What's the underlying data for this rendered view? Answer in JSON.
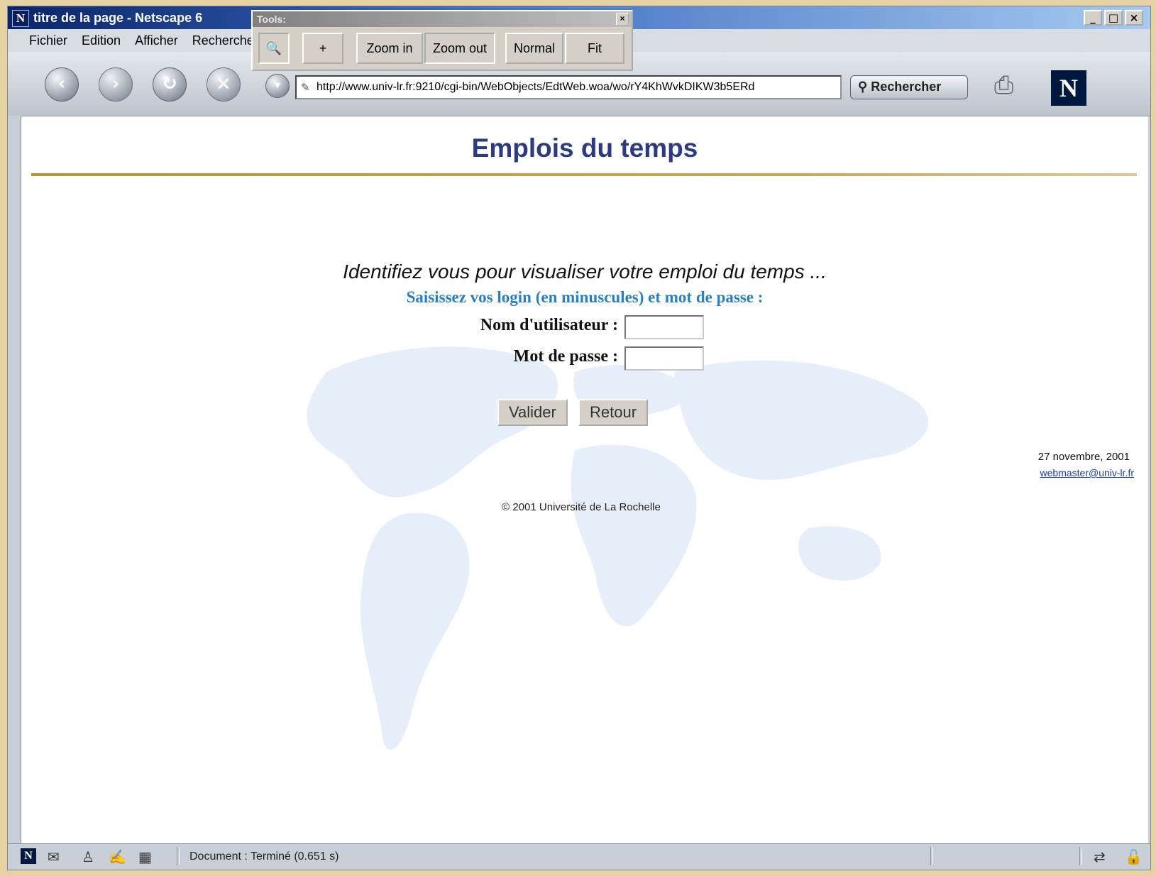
{
  "window": {
    "title": "titre de la page - Netscape 6",
    "app_icon": "N",
    "minimize": "_",
    "maximize": "□",
    "close": "×"
  },
  "menu": [
    "Fichier",
    "Edition",
    "Afficher",
    "Recherche"
  ],
  "toolbar": {
    "url": "http://www.univ-lr.fr:9210/cgi-bin/WebObjects/EdtWeb.woa/wo/rY4KhWvkDIKW3b5ERd",
    "search_label": "Rechercher",
    "logo": "N"
  },
  "tools": {
    "title": "Tools:",
    "close": "×",
    "buttons": [
      "Zoom in",
      "Zoom out",
      "Normal",
      "Fit"
    ]
  },
  "page": {
    "heading": "Emplois du temps",
    "prompt": "Identifiez vous pour visualiser votre emploi du temps ...",
    "instructions": "Saisissez vos login (en minuscules) et mot de passe :",
    "username_label": "Nom d'utilisateur :",
    "username_value": "",
    "password_label": "Mot de passe :",
    "password_value": "",
    "submit_label": "Valider",
    "back_label": "Retour",
    "date": "27 novembre, 2001",
    "webmaster": "webmaster@univ-lr.fr",
    "copyright": "© 2001 Université de La Rochelle"
  },
  "status": {
    "text": "Document : Terminé (0.651 s)"
  },
  "colors": {
    "heading": "#2d3a82",
    "instructions": "#2a7fc0",
    "rule": "#b6953c"
  },
  "icons": [
    "back-icon",
    "forward-icon",
    "reload-icon",
    "stop-icon",
    "home-icon",
    "search-icon",
    "printer-icon",
    "mail-icon",
    "composer-icon",
    "address-book-icon",
    "security-icon"
  ]
}
